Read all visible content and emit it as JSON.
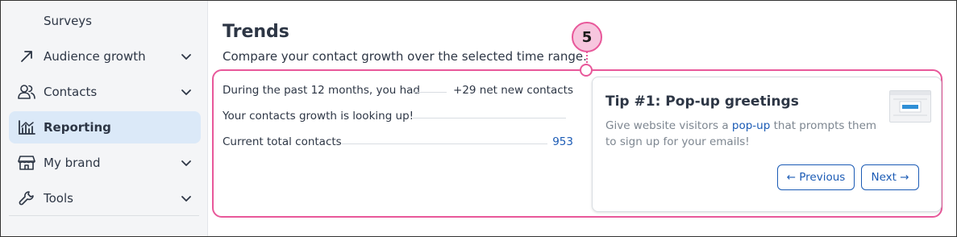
{
  "sidebar": {
    "sub_item": "Surveys",
    "items": [
      {
        "label": "Audience growth",
        "icon": "trend-arrow-icon",
        "chevron": true,
        "active": false
      },
      {
        "label": "Contacts",
        "icon": "contacts-icon",
        "chevron": true,
        "active": false
      },
      {
        "label": "Reporting",
        "icon": "reporting-chart-icon",
        "chevron": false,
        "active": true
      },
      {
        "label": "My brand",
        "icon": "storefront-icon",
        "chevron": true,
        "active": false
      },
      {
        "label": "Tools",
        "icon": "wrench-icon",
        "chevron": true,
        "active": false
      }
    ]
  },
  "main": {
    "title": "Trends",
    "subtitle": "Compare your contact growth over the selected time range.",
    "callout_number": "5",
    "stats": [
      {
        "label": "During the past 12 months, you had",
        "value": "+29 net new contacts",
        "is_link": false
      },
      {
        "label": "Your contacts growth is looking up!",
        "value": "",
        "is_link": false
      },
      {
        "label": "Current total contacts",
        "value": "953",
        "is_link": true
      }
    ],
    "tip": {
      "title": "Tip #1: Pop-up greetings",
      "body_before": "Give website visitors a ",
      "body_link": "pop-up",
      "body_after": " that prompts them to sign up for your emails!",
      "prev_label": "← Previous",
      "next_label": "Next →"
    }
  },
  "colors": {
    "accent_blue": "#1b5bb5",
    "active_bg": "#dbe9f8",
    "callout_pink": "#e8589a",
    "sidebar_bg": "#f4f5f7"
  }
}
